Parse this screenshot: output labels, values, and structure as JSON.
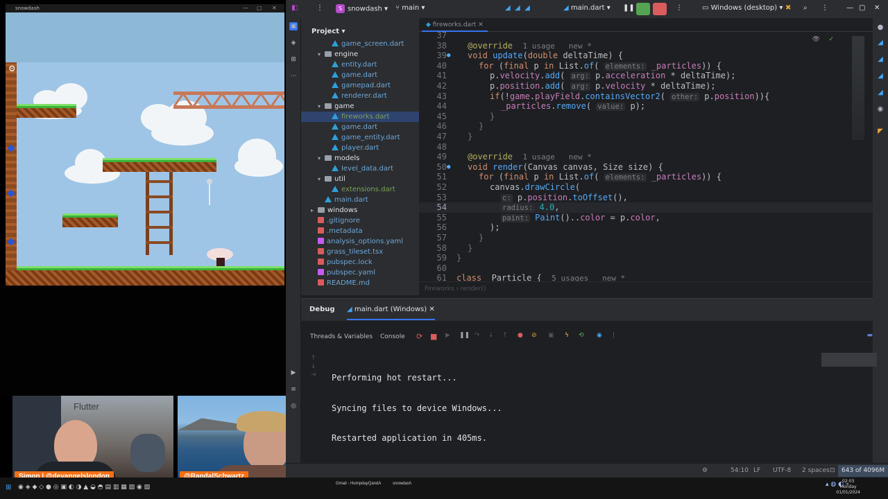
{
  "game": {
    "window_title": "snowdash"
  },
  "cams": {
    "simon_label": "Simon | @devangelslondon",
    "randal_label": "@RandalSchwartz",
    "banner_word": "Flutter"
  },
  "taskbar": {
    "items": [
      "Gmail - HumpdayQandA",
      "snowdash"
    ],
    "time": "02:03",
    "day": "Monday",
    "date": "01/01/2024"
  },
  "ide": {
    "project_name": "snowdash",
    "project_badge": "S",
    "branch": "main",
    "run_config": "main.dart",
    "device": "Windows (desktop)",
    "panel_title": "Project",
    "tree": [
      {
        "label": "game_screen.dart",
        "type": "dart",
        "indent": 3
      },
      {
        "label": "engine",
        "type": "folder",
        "indent": 2,
        "open": true
      },
      {
        "label": "entity.dart",
        "type": "dart",
        "indent": 3
      },
      {
        "label": "game.dart",
        "type": "dart",
        "indent": 3
      },
      {
        "label": "gamepad.dart",
        "type": "dart",
        "indent": 3
      },
      {
        "label": "renderer.dart",
        "type": "dart",
        "indent": 3
      },
      {
        "label": "game",
        "type": "folder",
        "indent": 2,
        "open": true
      },
      {
        "label": "fireworks.dart",
        "type": "dart",
        "indent": 3,
        "selected": true,
        "modified": true
      },
      {
        "label": "game.dart",
        "type": "dart",
        "indent": 3
      },
      {
        "label": "game_entity.dart",
        "type": "dart",
        "indent": 3
      },
      {
        "label": "player.dart",
        "type": "dart",
        "indent": 3
      },
      {
        "label": "models",
        "type": "folder",
        "indent": 2,
        "open": true
      },
      {
        "label": "level_data.dart",
        "type": "dart",
        "indent": 3
      },
      {
        "label": "util",
        "type": "folder",
        "indent": 2,
        "open": true
      },
      {
        "label": "extensions.dart",
        "type": "dart",
        "indent": 3,
        "modified": true
      },
      {
        "label": "main.dart",
        "type": "dart",
        "indent": 2
      },
      {
        "label": "windows",
        "type": "folder",
        "indent": 1,
        "open": false
      },
      {
        "label": ".gitignore",
        "type": "red",
        "indent": 1
      },
      {
        "label": ".metadata",
        "type": "red",
        "indent": 1
      },
      {
        "label": "analysis_options.yaml",
        "type": "yaml",
        "indent": 1
      },
      {
        "label": "grass_tileset.tsx",
        "type": "red",
        "indent": 1
      },
      {
        "label": "pubspec.lock",
        "type": "red",
        "indent": 1
      },
      {
        "label": "pubspec.yaml",
        "type": "yaml",
        "indent": 1
      },
      {
        "label": "README.md",
        "type": "red",
        "indent": 1
      }
    ],
    "editor_tab": "fireworks.dart",
    "breadcrumb": "Fireworks  ›  render()",
    "debug_tab": "Debug",
    "debug_session": "main.dart (Windows)",
    "subtab_threads": "Threads & Variables",
    "subtab_console": "Console",
    "console_lines": [
      "Performing hot restart...",
      "Syncing files to device Windows...",
      "Restarted application in 405ms."
    ],
    "status": {
      "position": "54:10",
      "line_sep": "LF",
      "encoding": "UTF-8",
      "indent": "2 spaces",
      "memory": "643 of 4096M"
    }
  }
}
